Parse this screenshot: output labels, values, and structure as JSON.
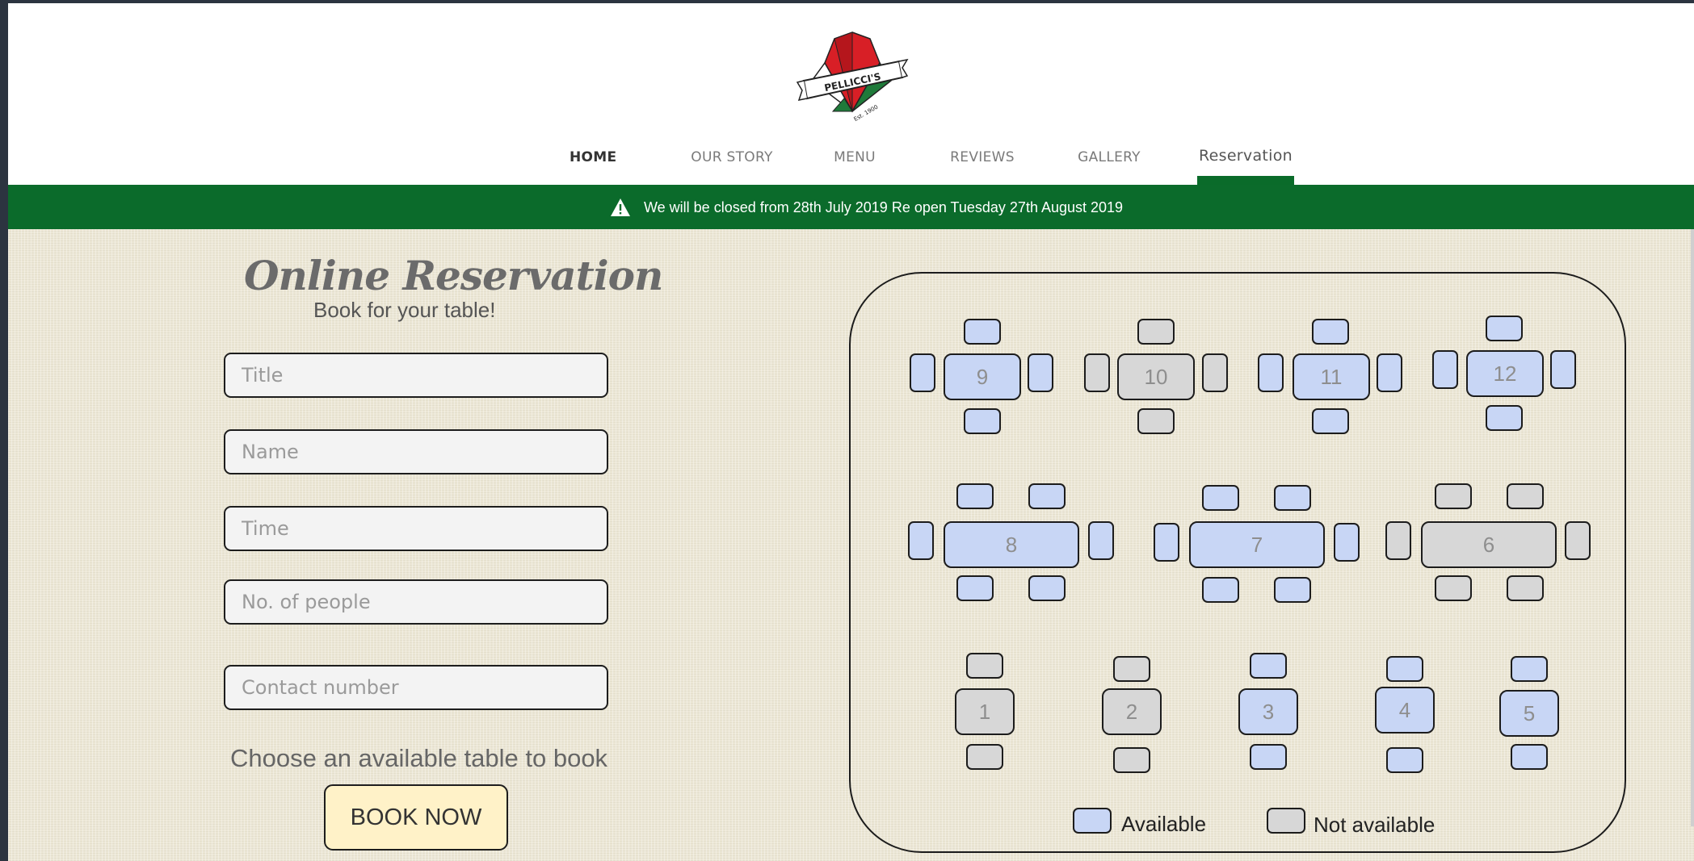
{
  "brand": {
    "logo_text": "PELLICCI'S",
    "logo_est": "Est. 1900"
  },
  "nav": {
    "items": [
      {
        "id": "home",
        "label": "HOME"
      },
      {
        "id": "our-story",
        "label": "OUR STORY"
      },
      {
        "id": "menu",
        "label": "MENU"
      },
      {
        "id": "reviews",
        "label": "REVIEWS"
      },
      {
        "id": "gallery",
        "label": "GALLERY"
      },
      {
        "id": "reservation",
        "label": "Reservation"
      }
    ],
    "active": "home",
    "highlighted": "reservation"
  },
  "banner": {
    "icon": "warning-triangle-icon",
    "text": "We will be closed from 28th July 2019 Re open Tuesday 27th August 2019"
  },
  "form": {
    "title": "Online Reservation",
    "subtitle": "Book for your table!",
    "fields": {
      "title_placeholder": "Title",
      "name_placeholder": "Name",
      "time_placeholder": "Time",
      "people_placeholder": "No. of people",
      "contact_placeholder": "Contact number"
    },
    "choose_text": "Choose an available table to book",
    "book_label": "BOOK NOW"
  },
  "floor_plan": {
    "tables": [
      {
        "number": "9",
        "status": "available"
      },
      {
        "number": "10",
        "status": "not_available"
      },
      {
        "number": "11",
        "status": "available"
      },
      {
        "number": "12",
        "status": "available"
      },
      {
        "number": "8",
        "status": "available"
      },
      {
        "number": "7",
        "status": "available"
      },
      {
        "number": "6",
        "status": "not_available"
      },
      {
        "number": "1",
        "status": "not_available"
      },
      {
        "number": "2",
        "status": "not_available"
      },
      {
        "number": "3",
        "status": "available"
      },
      {
        "number": "4",
        "status": "available"
      },
      {
        "number": "5",
        "status": "available"
      }
    ],
    "legend": {
      "available": "Available",
      "not_available": "Not available"
    }
  },
  "colors": {
    "available": "#c8d6f5",
    "not_available": "#d7d7d7",
    "banner": "#0b6b2b",
    "button": "#fff2c8"
  }
}
